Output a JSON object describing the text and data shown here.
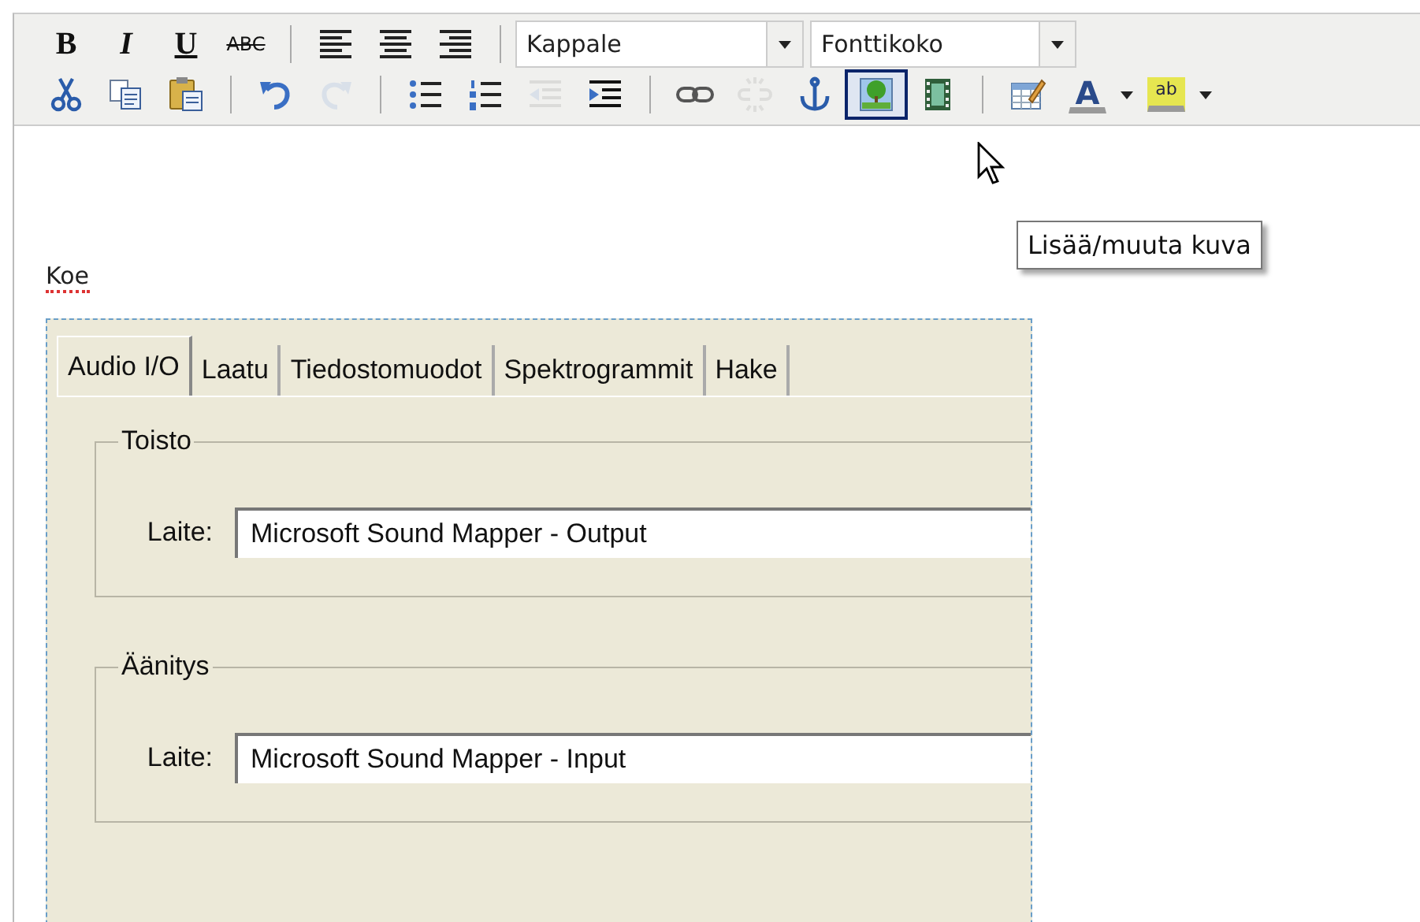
{
  "toolbar": {
    "rows": [
      [
        {
          "kind": "bold",
          "glyph": "B",
          "disabled": false
        },
        {
          "kind": "italic",
          "glyph": "I",
          "disabled": false
        },
        {
          "kind": "underline",
          "glyph": "U",
          "disabled": false
        },
        {
          "kind": "strike",
          "glyph": "ABC",
          "disabled": false
        },
        {
          "kind": "separator"
        },
        {
          "kind": "icon",
          "disabled": false,
          "highlighted": false
        },
        {
          "kind": "icon",
          "disabled": false,
          "highlighted": false
        },
        {
          "kind": "icon",
          "disabled": false,
          "highlighted": false
        },
        {
          "kind": "separator"
        },
        {
          "kind": "select",
          "value": "Kappale"
        },
        {
          "kind": "select",
          "value": "Fonttikoko"
        }
      ],
      [
        {
          "kind": "icon",
          "disabled": false,
          "highlighted": false
        },
        {
          "kind": "icon",
          "disabled": false,
          "highlighted": false
        },
        {
          "kind": "icon",
          "disabled": false,
          "highlighted": false
        },
        {
          "kind": "separator"
        },
        {
          "kind": "icon",
          "disabled": false,
          "highlighted": false
        },
        {
          "kind": "icon",
          "disabled": true,
          "highlighted": false
        },
        {
          "kind": "separator"
        },
        {
          "kind": "icon",
          "disabled": false,
          "highlighted": false
        },
        {
          "kind": "icon",
          "disabled": false,
          "highlighted": false
        },
        {
          "kind": "icon",
          "disabled": true,
          "highlighted": false
        },
        {
          "kind": "icon",
          "disabled": false,
          "highlighted": false
        },
        {
          "kind": "separator"
        },
        {
          "kind": "icon",
          "disabled": false,
          "highlighted": false
        },
        {
          "kind": "icon",
          "disabled": true,
          "highlighted": false
        },
        {
          "kind": "icon",
          "disabled": false,
          "highlighted": false
        },
        {
          "kind": "icon",
          "disabled": false,
          "highlighted": true
        },
        {
          "kind": "icon",
          "disabled": false,
          "highlighted": false
        },
        {
          "kind": "separator"
        },
        {
          "kind": "icon",
          "disabled": false,
          "highlighted": false
        },
        {
          "kind": "color",
          "glyph": "A",
          "disabled": false
        },
        {
          "kind": "dropdown"
        },
        {
          "kind": "highlight",
          "glyph": "ab",
          "disabled": false
        },
        {
          "kind": "dropdown"
        }
      ]
    ]
  },
  "tooltip": {
    "text": "Lisää/muuta kuva"
  },
  "editor": {
    "paragraph": "Koe",
    "spelling_error": true
  },
  "embedded_window": {
    "tabs": [
      {
        "label": "Audio I/O",
        "selected": true
      },
      {
        "label": "Laatu",
        "selected": false
      },
      {
        "label": "Tiedostomuodot",
        "selected": false
      },
      {
        "label": "Spektrogrammit",
        "selected": false
      },
      {
        "label": "Hake",
        "selected": false
      }
    ],
    "groups": [
      {
        "title": "Toisto",
        "fields": [
          {
            "label": "Laite:",
            "value": "Microsoft Sound Mapper - Output"
          }
        ]
      },
      {
        "title": "Äänitys",
        "fields": [
          {
            "label": "Laite:",
            "value": "Microsoft Sound Mapper - Input"
          }
        ]
      }
    ]
  }
}
